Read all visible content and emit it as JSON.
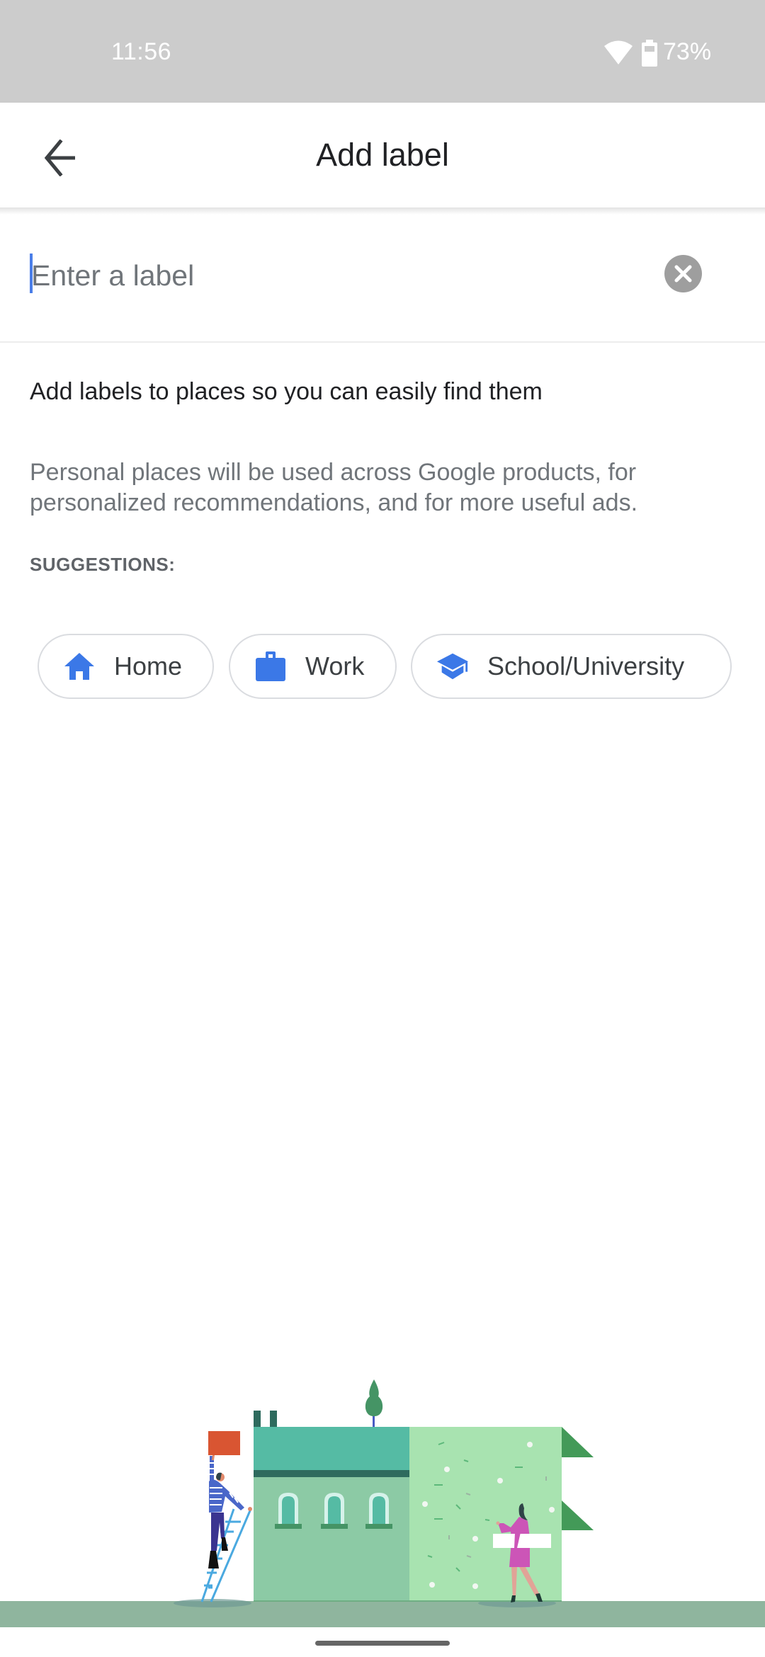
{
  "status_bar": {
    "time": "11:56",
    "wifi_icon": "wifi-icon",
    "battery_icon": "battery-icon",
    "battery_percent": "73%"
  },
  "app_bar": {
    "back_icon": "arrow-back-icon",
    "title": "Add label"
  },
  "label_input": {
    "value": "",
    "placeholder": "Enter a label",
    "clear_icon": "clear-circle-icon"
  },
  "content": {
    "heading": "Add labels to places so you can easily find them",
    "disclaimer": "Personal places will be used across Google products, for personalized recommendations, and for more useful ads.",
    "suggestions_label": "SUGGESTIONS:"
  },
  "suggestions": [
    {
      "label": "Home",
      "icon": "home-icon"
    },
    {
      "label": "Work",
      "icon": "briefcase-icon"
    },
    {
      "label": "School/University",
      "icon": "graduation-cap-icon"
    }
  ],
  "colors": {
    "accent": "#3b78e7",
    "status_bar_bg": "#cccccc",
    "text_primary": "#202124",
    "text_secondary": "#70757a"
  },
  "illustration": {
    "subject": "people-decorating-building-illustration"
  }
}
